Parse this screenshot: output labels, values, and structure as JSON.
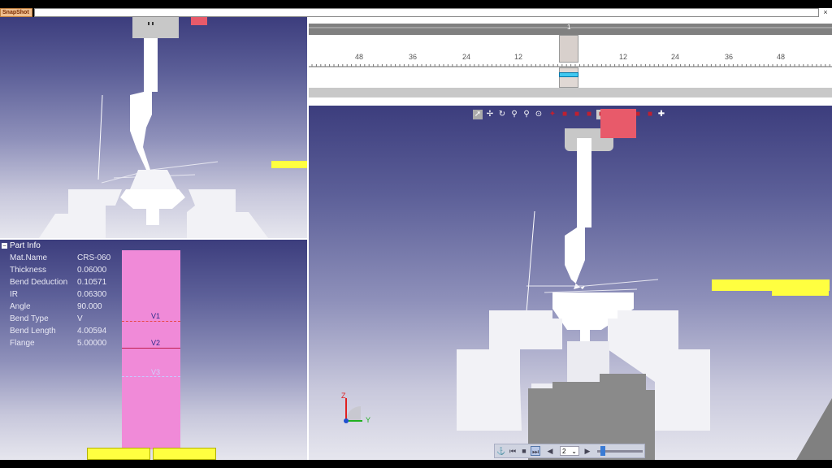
{
  "window": {
    "tab_label": "SnapShot",
    "close_glyph": "×"
  },
  "part_info": {
    "header": "Part Info",
    "collapse_glyph": "−",
    "rows": [
      {
        "label": "Mat.Name",
        "value": "CRS-060"
      },
      {
        "label": "Thickness",
        "value": "0.06000"
      },
      {
        "label": "Bend Deduction",
        "value": "0.10571"
      },
      {
        "label": "IR",
        "value": "0.06300"
      },
      {
        "label": "Angle",
        "value": "90.000"
      },
      {
        "label": "Bend Type",
        "value": "V"
      },
      {
        "label": "Bend Length",
        "value": "4.00594"
      },
      {
        "label": "Flange",
        "value": "5.00000"
      }
    ]
  },
  "bend_lines": {
    "v1": "V1",
    "v2": "V2",
    "v3": "V3"
  },
  "ruler": {
    "marker_label": "1",
    "ticks": [
      "48",
      "36",
      "24",
      "12",
      "12",
      "24",
      "36",
      "48"
    ]
  },
  "axes": {
    "z": "Z",
    "y": "Y"
  },
  "toolbar_icons": [
    "select-icon",
    "pan-icon",
    "rotate-icon",
    "zoom-in-icon",
    "zoom-out-icon",
    "zoom-fit-icon",
    "view-iso-icon",
    "view-front-icon",
    "view-back-icon",
    "view-left-icon",
    "view-right-icon",
    "view-top-icon",
    "view-bottom-icon",
    "view-3d-icon",
    "view-cube-icon",
    "settings-icon"
  ],
  "playbar": {
    "step_value": "2",
    "dropdown_glyph": "⌄"
  },
  "colors": {
    "pink_part": "#f08ad8",
    "yellow_marker": "#ffff40",
    "red_marker": "#e85a6a",
    "bend_dash_red": "#e84848",
    "bend_dash_white": "#c8c8ff"
  }
}
